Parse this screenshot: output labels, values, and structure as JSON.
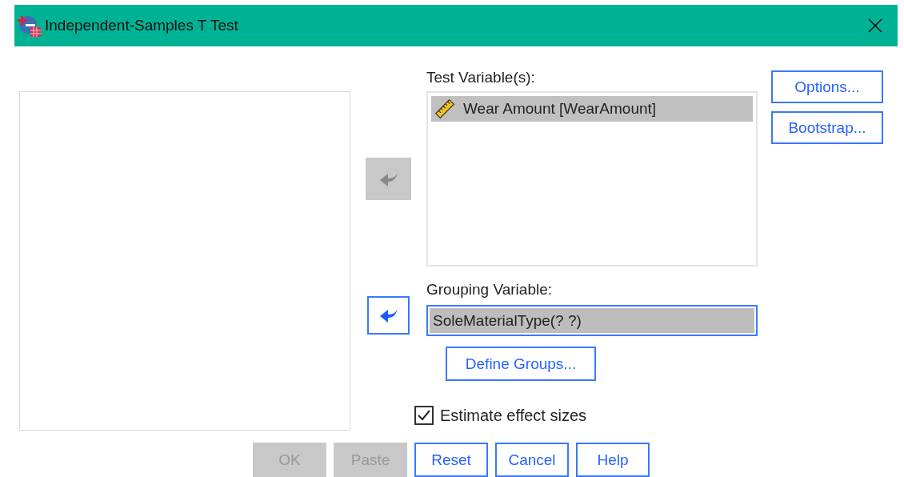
{
  "window": {
    "title": "Independent-Samples T Test"
  },
  "test_variables": {
    "label": "Test Variable(s):",
    "items": [
      {
        "text": "Wear Amount [WearAmount]",
        "selected": true
      }
    ]
  },
  "move_buttons": [
    {
      "disabled": true
    },
    {
      "disabled": false
    }
  ],
  "grouping_variable": {
    "label": "Grouping Variable:",
    "value": "SoleMaterialType(? ?)"
  },
  "define_groups": {
    "label": "Define Groups..."
  },
  "estimate_effect_sizes": {
    "label": "Estimate effect sizes",
    "checked": true
  },
  "side_buttons": [
    {
      "label": "Options..."
    },
    {
      "label": "Bootstrap..."
    }
  ],
  "buttons": [
    {
      "label": "OK",
      "disabled": true
    },
    {
      "label": "Paste",
      "disabled": true
    },
    {
      "label": "Reset",
      "disabled": false
    },
    {
      "label": "Cancel",
      "disabled": false
    },
    {
      "label": "Help",
      "disabled": false
    }
  ]
}
